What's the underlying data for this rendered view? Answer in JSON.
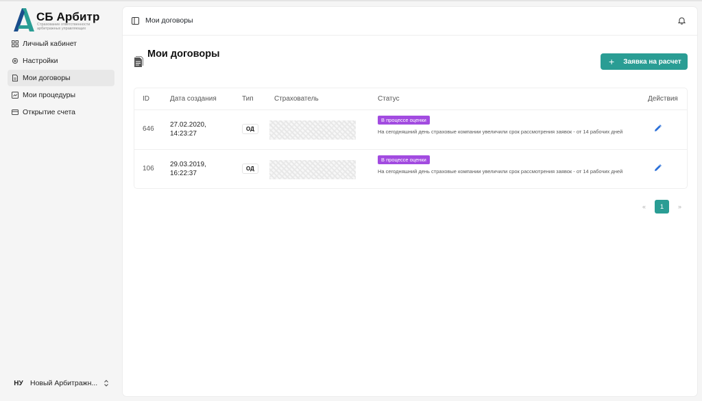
{
  "app": {
    "logo_title": "СБ Арбитр",
    "logo_subtitle": "Страхование ответственности арбитражных управляющих"
  },
  "sidebar": {
    "items": [
      {
        "label": "Личный кабинет",
        "icon": "grid-icon",
        "active": false
      },
      {
        "label": "Настройки",
        "icon": "gear-icon",
        "active": false
      },
      {
        "label": "Мои договоры",
        "icon": "document-icon",
        "active": true
      },
      {
        "label": "Мои процедуры",
        "icon": "procedure-icon",
        "active": false
      },
      {
        "label": "Открытие счета",
        "icon": "card-icon",
        "active": false
      }
    ],
    "user": {
      "initials": "НУ",
      "name": "Новый Арбитражн..."
    }
  },
  "header": {
    "breadcrumb": "Мои договоры"
  },
  "page": {
    "title": "Мои договоры",
    "request_button_label": "Заявка на расчет"
  },
  "table": {
    "columns": {
      "id": "ID",
      "created": "Дата создания",
      "type": "Тип",
      "insurer": "Страхователь",
      "status": "Статус",
      "actions": "Действия"
    },
    "rows": [
      {
        "id": "646",
        "date": "27.02.2020,",
        "time": "14:23:27",
        "type": "ОД",
        "status": "В процессе оценки",
        "note": "На сегодняшний день страховые компании увеличили срок рассмотрения заявок - от 14 рабочих дней"
      },
      {
        "id": "106",
        "date": "29.03.2019,",
        "time": "16:22:37",
        "type": "ОД",
        "status": "В процессе оценки",
        "note": "На сегодняшний день страховые компании увеличили срок рассмотрения заявок - от 14 рабочих дней"
      }
    ]
  },
  "pagination": {
    "prev": "«",
    "current": "1",
    "next": "»"
  },
  "colors": {
    "accent": "#2a9d94",
    "status": "#a24be0"
  }
}
